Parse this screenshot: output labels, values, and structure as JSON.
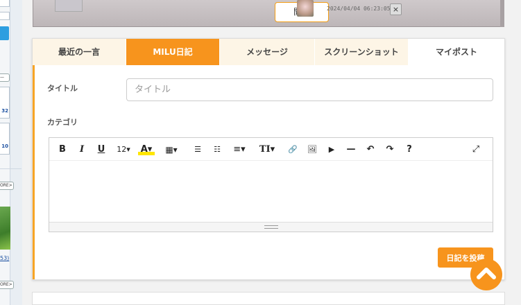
{
  "top_bar": {
    "open_button": "開く",
    "timestamp": "2024/04/04 06:23:05",
    "close_label": "×"
  },
  "tabs": [
    {
      "label": "最近の一言",
      "active": false
    },
    {
      "label": "MILU日記",
      "active": true
    },
    {
      "label": "メッセージ",
      "active": false
    },
    {
      "label": "スクリーンショット",
      "active": false
    },
    {
      "label": "マイポスト",
      "active": false
    }
  ],
  "form": {
    "title_label": "タイトル",
    "title_placeholder": "タイトル",
    "title_value": "",
    "category_label": "カテゴリ",
    "submit_label": "日記を投稿"
  },
  "toolbar": {
    "bold": "B",
    "italic": "I",
    "underline": "U",
    "font_size": "12▾",
    "text_color": "A▾",
    "table": "▦▾",
    "bullet_list": "☰",
    "numbered_list": "☷",
    "align": "≡▾",
    "style": "TI▾",
    "link": "🔗",
    "image": "🖼",
    "video": "▶",
    "hr": "—",
    "undo": "↶",
    "redo": "↷",
    "help": "?",
    "fullscreen": "⤢"
  },
  "sidebar": {
    "nums": [
      "32",
      "10"
    ],
    "more_labels": [
      "ORE>",
      "ORE>"
    ],
    "link": "53)"
  },
  "colors": {
    "accent": "#f7941d",
    "tab_bg": "#fdf5e6",
    "left_border": "#f7a425"
  }
}
